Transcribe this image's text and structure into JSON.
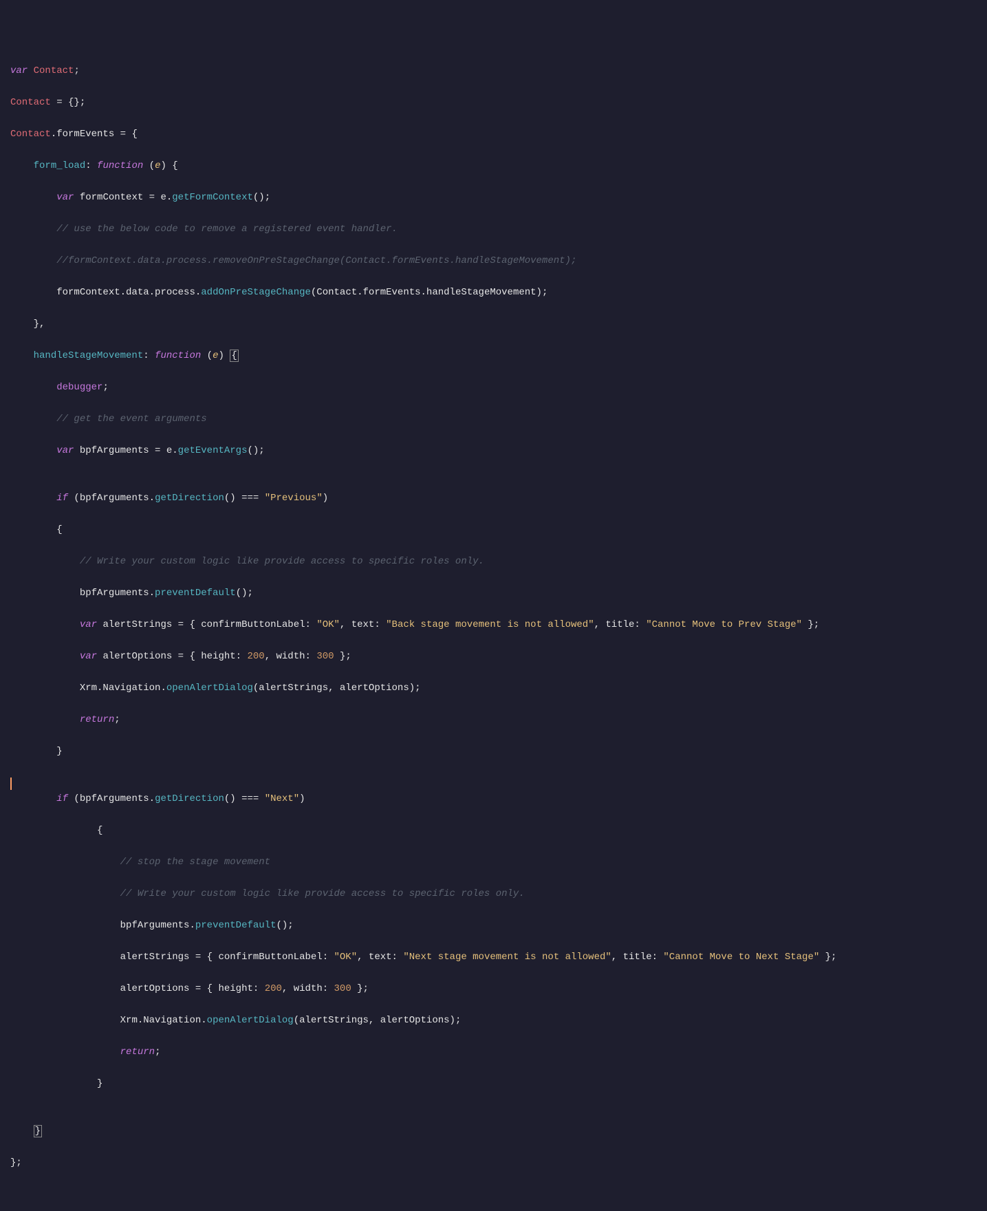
{
  "code": {
    "l1_var": "var",
    "l1_contact": "Contact",
    "l2_contact": "Contact",
    "l2_eq": " = {};",
    "l3_contact": "Contact",
    "l3_formEvents": ".formEvents",
    "l3_eq": " = {",
    "l4_formload": "form_load",
    "l4_colon": ": ",
    "l4_function": "function",
    "l4_paren": " (",
    "l4_e": "e",
    "l4_close": ") {",
    "l5_var": "var",
    "l5_fc": " formContext = e.",
    "l5_gfc": "getFormContext",
    "l5_end": "();",
    "l6_cmt": "// use the below code to remove a registered event handler.",
    "l7_cmt": "//formContext.data.process.removeOnPreStageChange(Contact.formEvents.handleStageMovement);",
    "l8_fc": "formContext.data.process.",
    "l8_add": "addOnPreStageChange",
    "l8_args": "(Contact.formEvents.handleStageMovement);",
    "l9_close": "},",
    "l10_hsm": "handleStageMovement",
    "l10_colon": ": ",
    "l10_function": "function",
    "l10_paren": " (",
    "l10_e": "e",
    "l10_close": ") ",
    "l10_brace": "{",
    "l11_dbg": "debugger",
    "l11_semi": ";",
    "l12_cmt": "// get the event arguments",
    "l13_var": "var",
    "l13_bpf": " bpfArguments = e.",
    "l13_gea": "getEventArgs",
    "l13_end": "();",
    "l15_if": "if",
    "l15_open": " (bpfArguments.",
    "l15_gd": "getDirection",
    "l15_mid": "() === ",
    "l15_prev": "\"Previous\"",
    "l15_close": ")",
    "l16_brace": "{",
    "l17_cmt": "// Write your custom logic like provide access to specific roles only.",
    "l18_bpf": "bpfArguments.",
    "l18_pd": "preventDefault",
    "l18_end": "();",
    "l19_var": "var",
    "l19_as": " alertStrings = { confirmButtonLabel: ",
    "l19_ok": "\"OK\"",
    "l19_text": ", text: ",
    "l19_msg": "\"Back stage movement is not allowed\"",
    "l19_title": ", title: ",
    "l19_titlemsg": "\"Cannot Move to Prev Stage\"",
    "l19_end": " };",
    "l20_var": "var",
    "l20_ao": " alertOptions = { height: ",
    "l20_h": "200",
    "l20_w": ", width: ",
    "l20_wn": "300",
    "l20_end": " };",
    "l21_xrm": "Xrm.Navigation.",
    "l21_oad": "openAlertDialog",
    "l21_args": "(alertStrings, alertOptions);",
    "l22_return": "return",
    "l22_semi": ";",
    "l23_brace": "}",
    "l25_if": "if",
    "l25_open": " (bpfArguments.",
    "l25_gd": "getDirection",
    "l25_mid": "() === ",
    "l25_next": "\"Next\"",
    "l25_close": ")",
    "l26_brace": "{",
    "l27_cmt": "// stop the stage movement",
    "l28_cmt": "// Write your custom logic like provide access to specific roles only.",
    "l29_bpf": "bpfArguments.",
    "l29_pd": "preventDefault",
    "l29_end": "();",
    "l30_as": "alertStrings = { confirmButtonLabel: ",
    "l30_ok": "\"OK\"",
    "l30_text": ", text: ",
    "l30_msg": "\"Next stage movement is not allowed\"",
    "l30_title": ", title: ",
    "l30_titlemsg": "\"Cannot Move to Next Stage\"",
    "l30_end": " };",
    "l31_ao": "alertOptions = { height: ",
    "l31_h": "200",
    "l31_w": ", width: ",
    "l31_wn": "300",
    "l31_end": " };",
    "l32_xrm": "Xrm.Navigation.",
    "l32_oad": "openAlertDialog",
    "l32_args": "(alertStrings, alertOptions);",
    "l33_return": "return",
    "l33_semi": ";",
    "l34_brace": "}",
    "l36_brace": "}",
    "l37_close": "};"
  }
}
